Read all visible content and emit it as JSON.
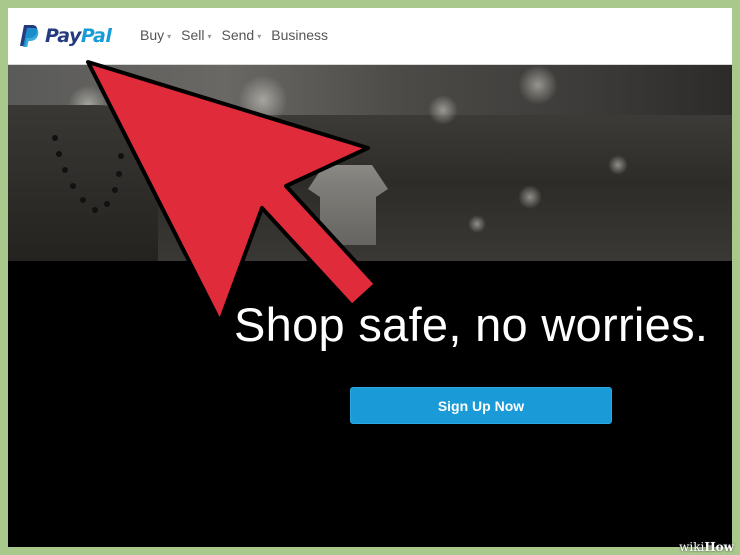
{
  "header": {
    "logo": {
      "part1": "Pay",
      "part2": "Pal",
      "icon": "paypal-logo-icon"
    },
    "nav": [
      {
        "label": "Buy",
        "has_dropdown": true
      },
      {
        "label": "Sell",
        "has_dropdown": true
      },
      {
        "label": "Send",
        "has_dropdown": true
      },
      {
        "label": "Business",
        "has_dropdown": false
      }
    ]
  },
  "hero": {
    "headline": "Shop safe, no worries.",
    "cta_label": "Sign Up Now"
  },
  "annotation": {
    "icon": "red-pointer-arrow-icon",
    "color": "#e02b3a"
  },
  "watermark": {
    "prefix": "wiki",
    "suffix": "How"
  },
  "colors": {
    "paypal_dark_blue": "#253b80",
    "paypal_light_blue": "#179bd7",
    "cta_blue": "#1a9ad6",
    "border_green": "#a9c98c"
  }
}
